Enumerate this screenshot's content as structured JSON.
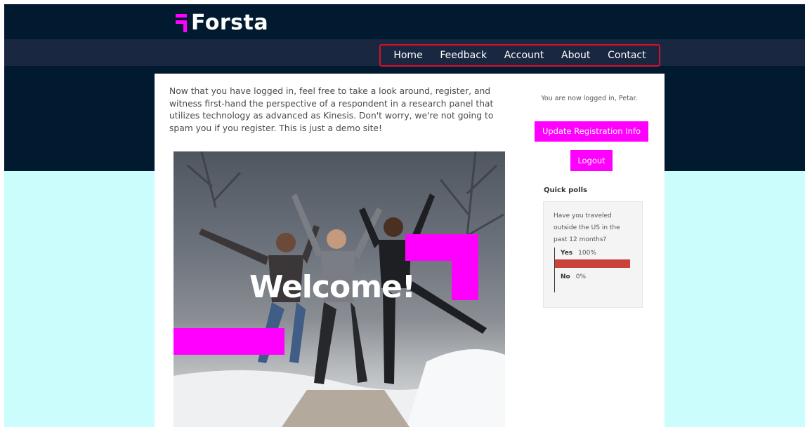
{
  "header": {
    "logo_text": "Forsta",
    "brand_color": "#ff00ff",
    "background_color": "#021a30"
  },
  "nav": {
    "items": [
      "Home",
      "Feedback",
      "Account",
      "About",
      "Contact"
    ]
  },
  "main": {
    "intro_text": "Now that you have logged in, feel free to take a look around, register, and witness first-hand the perspective of a respondent in a research panel that utilizes technology as advanced as Kinesis. Don't worry, we're not going to spam you if you register. This is just a demo site!",
    "hero": {
      "overlay_text": "Welcome!"
    }
  },
  "sidebar": {
    "login_message": "You are now logged in, Petar.",
    "update_button": "Update Registration Info",
    "logout_button": "Logout",
    "polls_heading": "Quick polls",
    "poll": {
      "question": "Have you traveled outside the US in the past 12 months?",
      "options": [
        {
          "label": "Yes",
          "percent_text": "100%",
          "fraction": 1.0
        },
        {
          "label": "No",
          "percent_text": "0%",
          "fraction": 0.0
        }
      ],
      "bar_color": "#c9423c"
    }
  }
}
